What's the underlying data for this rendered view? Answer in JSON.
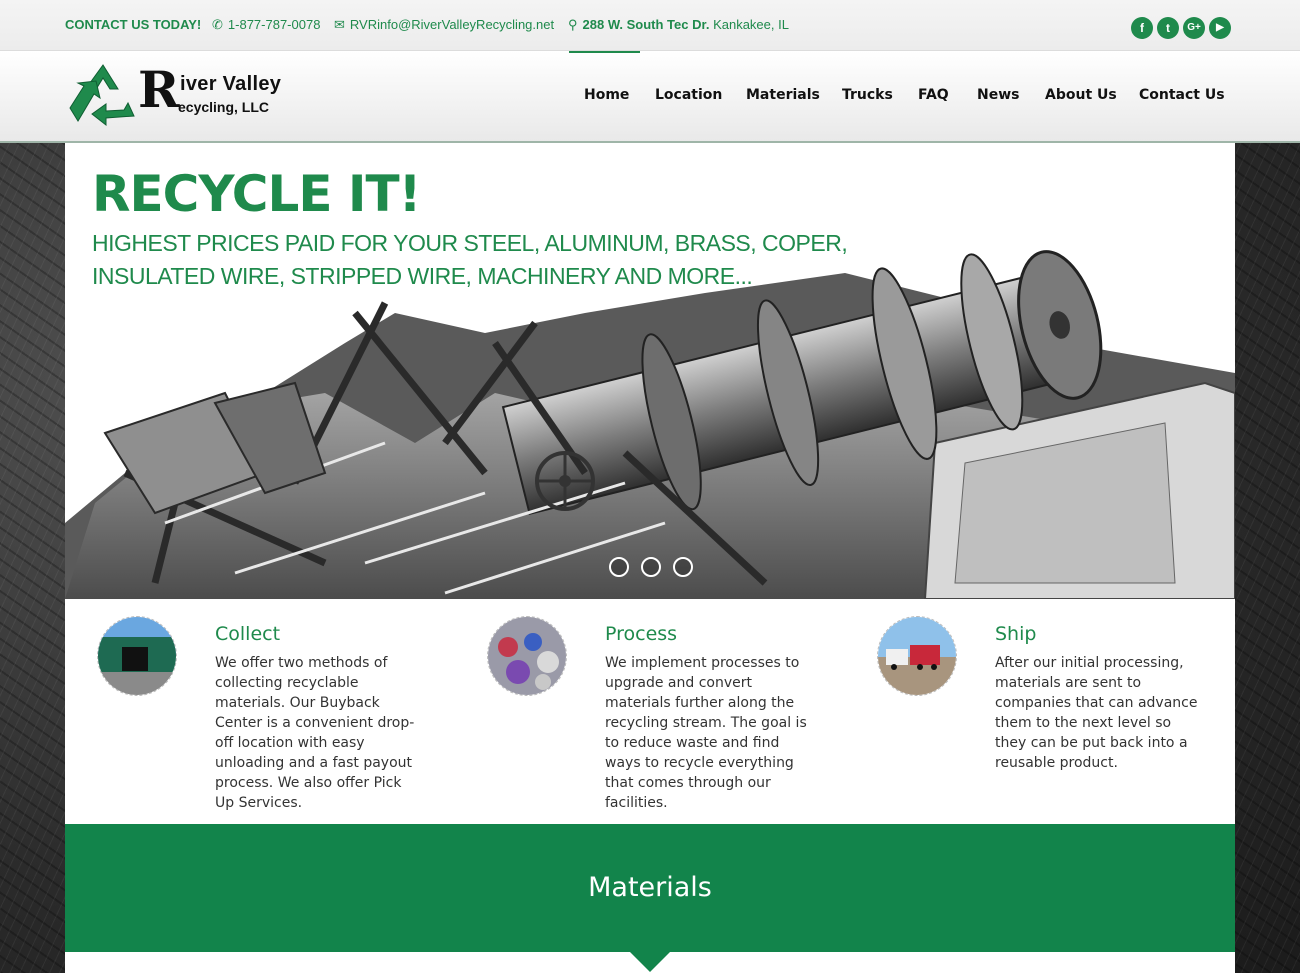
{
  "topbar": {
    "contact_title": "CONTACT US TODAY!",
    "phone": "1-877-787-0078",
    "email": "RVRinfo@RiverValleyRecycling.net",
    "address_street": "288 W. South Tec Dr.",
    "address_city": "Kankakee, IL",
    "social": [
      {
        "icon": "facebook-icon",
        "glyph": "f"
      },
      {
        "icon": "twitter-icon",
        "glyph": "t"
      },
      {
        "icon": "google-plus-icon",
        "glyph": "G+"
      },
      {
        "icon": "youtube-icon",
        "glyph": "▶"
      }
    ]
  },
  "logo": {
    "letter": "R",
    "line1": "iver Valley",
    "line2": "ecycling, LLC",
    "icon": "recycle-icon"
  },
  "nav": {
    "items": [
      "Home",
      "Location",
      "Materials",
      "Trucks",
      "FAQ",
      "News",
      "About Us",
      "Contact Us"
    ],
    "active": "Home"
  },
  "hero": {
    "title": "RECYCLE IT!",
    "subtitle_line1": "HIGHEST PRICES PAID FOR YOUR STEEL, ALUMINUM, BRASS, COPER,",
    "subtitle_line2": "INSULATED WIRE, STRIPPED WIRE, MACHINERY AND MORE...",
    "slides": 3,
    "active_slide": 1
  },
  "features": [
    {
      "title": "Collect",
      "text": "We offer two methods of collecting recyclable materials. Our Buyback Center is a convenient drop-off location with easy unloading and a fast payout process. We also offer Pick Up Services."
    },
    {
      "title": "Process",
      "text": "We implement processes to upgrade and convert materials further along the recycling stream. The goal is to reduce waste and find ways to recycle everything that comes through our facilities."
    },
    {
      "title": "Ship",
      "text": "After our initial processing, materials are sent to companies that can advance them to the next level so they can be put back into a reusable product."
    }
  ],
  "materials": {
    "title": "Materials"
  },
  "colors": {
    "brand_green": "#1f8a4c",
    "band_green": "#12844b"
  }
}
